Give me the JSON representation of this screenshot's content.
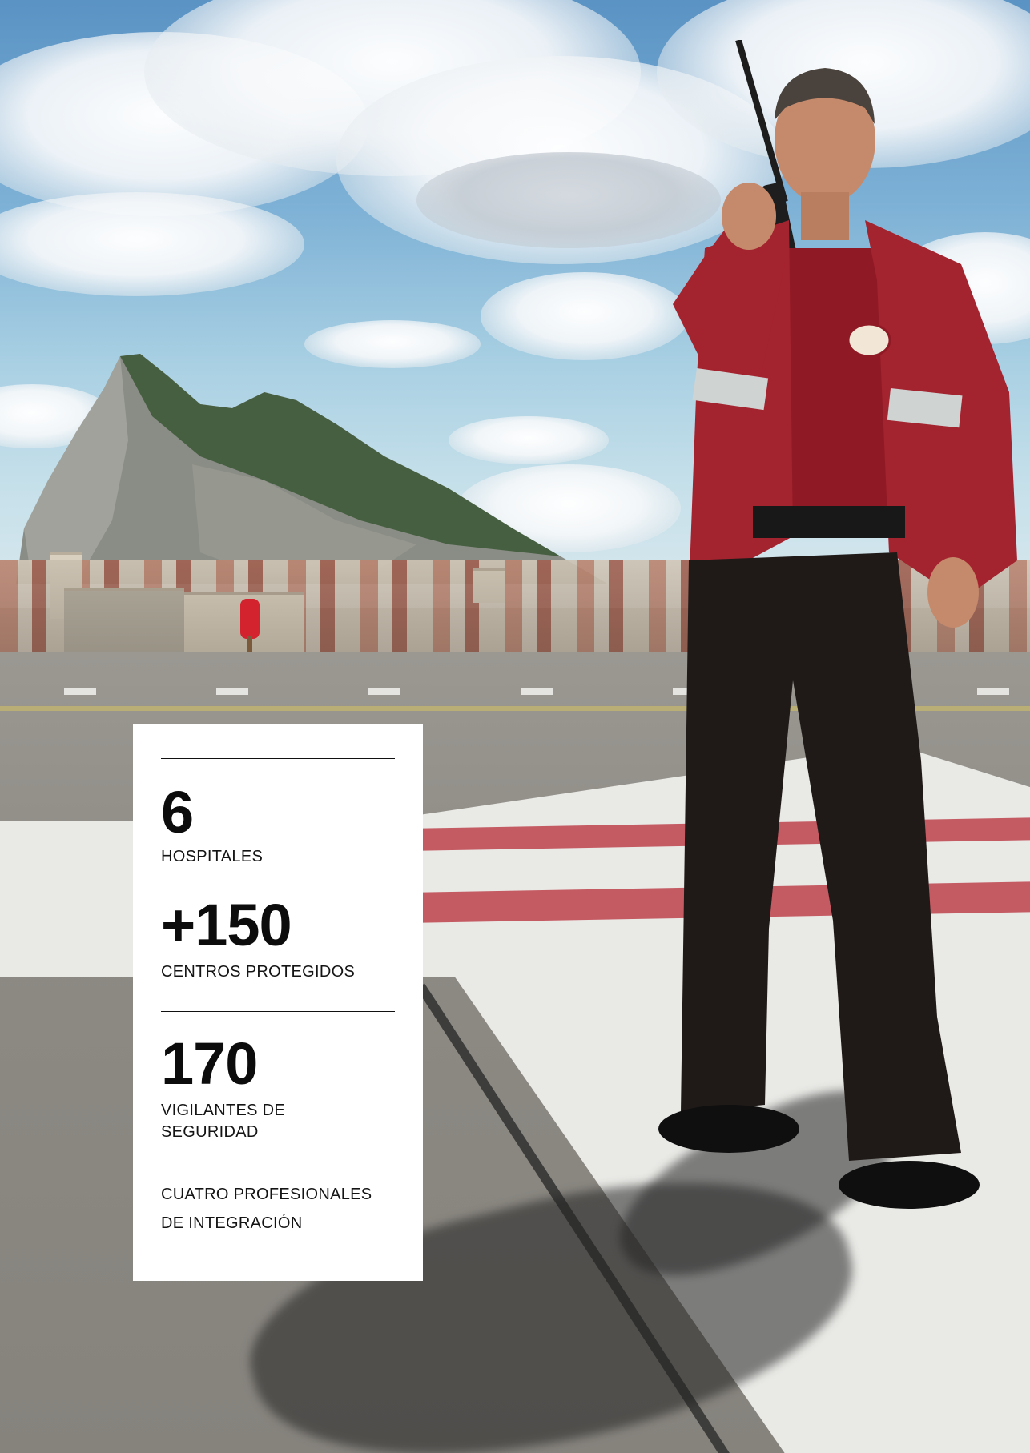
{
  "stats": [
    {
      "value": "6",
      "label": "HOSPITALES"
    },
    {
      "value": "+150",
      "label": "CENTROS PROTEGIDOS"
    },
    {
      "value": "170",
      "label": "VIGILANTES DE SEGURIDAD"
    }
  ],
  "footnote_line1": "CUATRO PROFESIONALES",
  "footnote_line2": "DE INTEGRACIÓN",
  "colors": {
    "card": "#ffffff",
    "text": "#0c0c0c",
    "jacket": "#a3232f",
    "sky": "#7fb2d6"
  }
}
